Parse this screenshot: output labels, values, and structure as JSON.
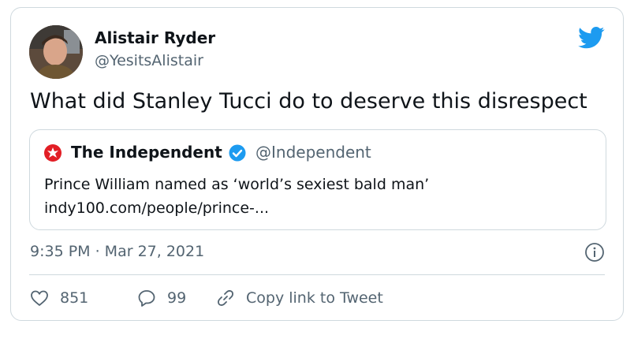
{
  "tweet": {
    "author_name": "Alistair Ryder",
    "author_handle": "@YesitsAlistair",
    "text": "What did Stanley Tucci do to deserve this disrespect",
    "timestamp": "9:35 PM · Mar 27, 2021",
    "likes": "851",
    "replies": "99",
    "copy_link_label": "Copy link to Tweet"
  },
  "quote": {
    "author_name": "The Independent",
    "author_handle": "@Independent",
    "text_line1": "Prince William named as ‘world’s sexiest bald man’",
    "text_line2": "indy100.com/people/prince-..."
  },
  "colors": {
    "twitter_blue": "#1d9bf0",
    "independent_red": "#e21e25",
    "muted_text": "#536471",
    "border": "#cfd9de"
  },
  "icons": [
    "avatar-photo",
    "twitter-bird-icon",
    "independent-logo-icon",
    "verified-badge-icon",
    "info-icon",
    "heart-icon",
    "reply-icon",
    "link-icon"
  ]
}
